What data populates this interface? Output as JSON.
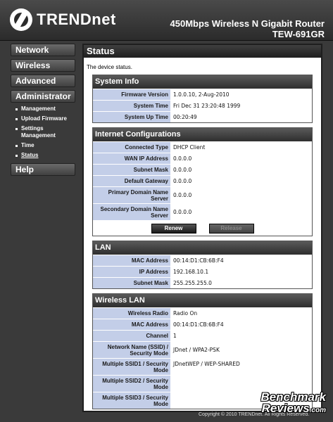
{
  "brand": {
    "name": "TRENDnet"
  },
  "header": {
    "product_line1": "450Mbps Wireless N Gigabit Router",
    "product_line2": "TEW-691GR"
  },
  "sidebar": {
    "network": "Network",
    "wireless": "Wireless",
    "advanced": "Advanced",
    "administrator": "Administrator",
    "submenu": [
      "Management",
      "Upload Firmware",
      "Settings Management",
      "Time",
      "Status"
    ],
    "help": "Help"
  },
  "main": {
    "title": "Status",
    "description": "The device status."
  },
  "system_info": {
    "title": "System Info",
    "rows": [
      {
        "label": "Firmware Version",
        "value": "1.0.0.10, 2-Aug-2010"
      },
      {
        "label": "System Time",
        "value": "Fri Dec 31 23:20:48 1999"
      },
      {
        "label": "System Up Time",
        "value": "00:20:49"
      }
    ]
  },
  "internet": {
    "title": "Internet Configurations",
    "rows": [
      {
        "label": "Connected Type",
        "value": "DHCP Client"
      },
      {
        "label": "WAN IP Address",
        "value": "0.0.0.0"
      },
      {
        "label": "Subnet Mask",
        "value": "0.0.0.0"
      },
      {
        "label": "Default Gateway",
        "value": "0.0.0.0"
      },
      {
        "label": "Primary Domain Name Server",
        "value": "0.0.0.0"
      },
      {
        "label": "Secondary Domain Name Server",
        "value": "0.0.0.0"
      }
    ],
    "renew": "Renew",
    "release": "Release"
  },
  "lan": {
    "title": "LAN",
    "rows": [
      {
        "label": "MAC Address",
        "value": "00:14:D1:CB:6B:F4"
      },
      {
        "label": "IP Address",
        "value": "192.168.10.1"
      },
      {
        "label": "Subnet Mask",
        "value": "255.255.255.0"
      }
    ]
  },
  "wlan": {
    "title": "Wireless LAN",
    "rows": [
      {
        "label": "Wireless Radio",
        "value": "Radio On"
      },
      {
        "label": "MAC Address",
        "value": "00:14:D1:CB:6B:F4"
      },
      {
        "label": "Channel",
        "value": "1"
      },
      {
        "label": "Network Name (SSID) / Security Mode",
        "value": "JDnet / WPA2-PSK"
      },
      {
        "label": "Multiple SSID1 / Security Mode",
        "value": "JDnetWEP / WEP-SHARED"
      },
      {
        "label": "Multiple SSID2 / Security Mode",
        "value": ""
      },
      {
        "label": "Multiple SSID3 / Security Mode",
        "value": ""
      }
    ]
  },
  "footer": {
    "copyright": "Copyright © 2010 TRENDnet. All Rights Reserved."
  },
  "watermark": {
    "line1": "Benchmark",
    "line2": "Reviews",
    "domain": ".com"
  }
}
